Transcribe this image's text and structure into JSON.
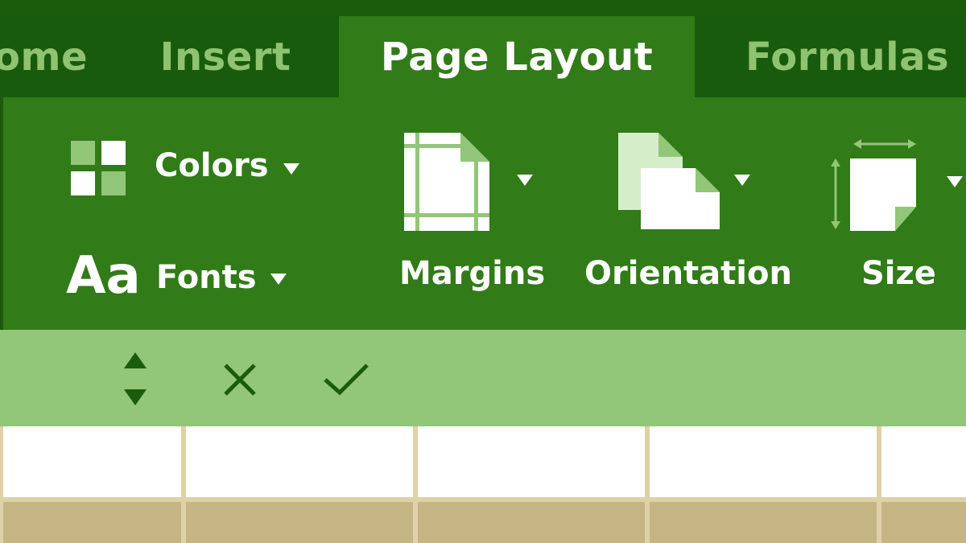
{
  "tabs": [
    {
      "label": "ome",
      "active": false
    },
    {
      "label": "Insert",
      "active": false
    },
    {
      "label": "Page Layout",
      "active": true
    },
    {
      "label": "Formulas",
      "active": false
    }
  ],
  "ribbon": {
    "colors_label": "Colors",
    "fonts_label": "Fonts",
    "fonts_icon_text": "Aa",
    "margins_label": "Margins",
    "orientation_label": "Orientation",
    "size_label": "Size"
  },
  "formula_bar": {
    "icons": [
      "up-down-arrows-icon",
      "cancel-x-icon",
      "confirm-check-icon"
    ]
  },
  "colors": {
    "dark_green": "#1a5c0c",
    "ribbon_green": "#317b18",
    "light_green": "#92c678",
    "tab_inactive_text": "#8fc271",
    "cell_tan": "#c5b585",
    "grid_line": "#dfd1a6"
  }
}
